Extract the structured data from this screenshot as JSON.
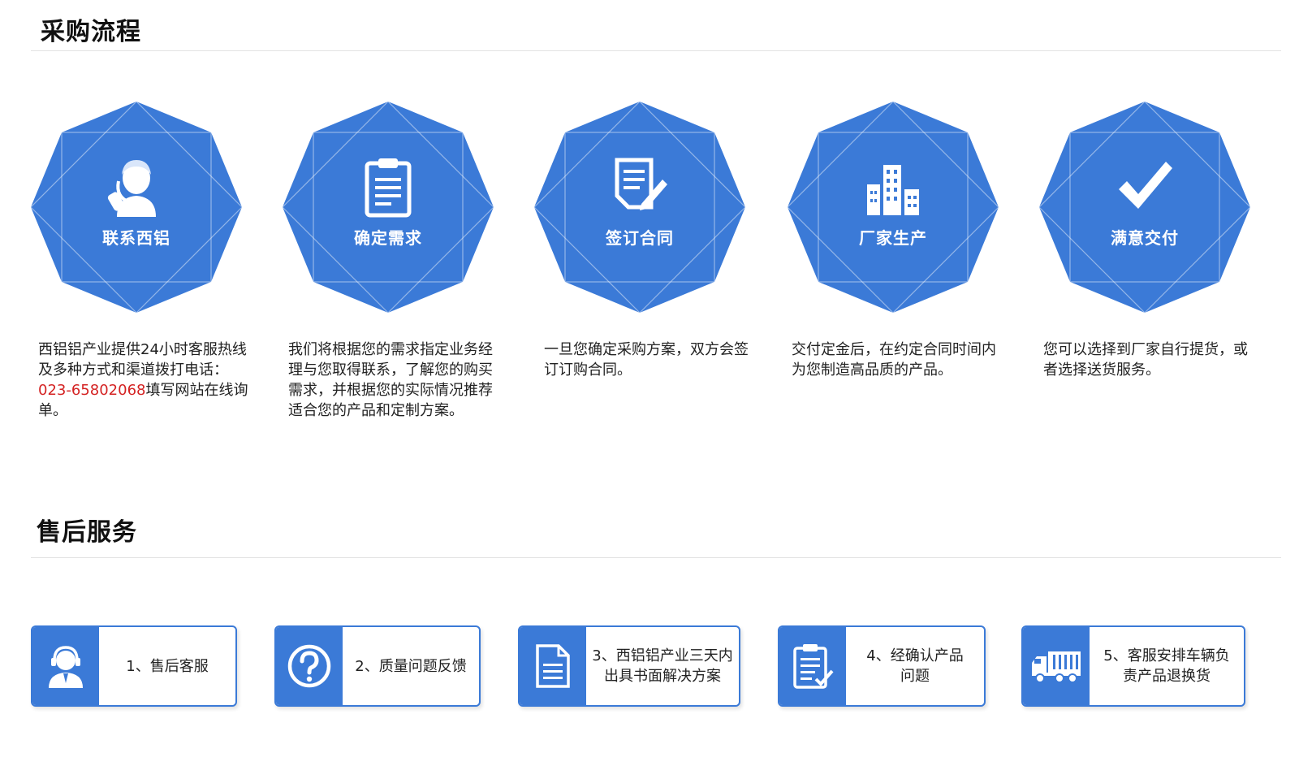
{
  "purchase": {
    "title": "采购流程",
    "steps": [
      {
        "label": "联系西铝",
        "icon": "customer-service-icon",
        "desc_before": "西铝铝产业提供24小时客服热线及多种方式和渠道拨打电话：",
        "phone": "023-65802068",
        "desc_after": "填写网站在线询单。"
      },
      {
        "label": "确定需求",
        "icon": "clipboard-icon",
        "desc": "我们将根据您的需求指定业务经理与您取得联系，了解您的购买需求，并根据您的实际情况推荐适合您的产品和定制方案。"
      },
      {
        "label": "签订合同",
        "icon": "contract-sign-icon",
        "desc": "一旦您确定采购方案，双方会签订订购合同。"
      },
      {
        "label": "厂家生产",
        "icon": "factory-building-icon",
        "desc": "交付定金后，在约定合同时间内为您制造高品质的产品。"
      },
      {
        "label": "满意交付",
        "icon": "checkmark-icon",
        "desc": "您可以选择到厂家自行提货，或者选择送货服务。"
      }
    ]
  },
  "after_sales": {
    "title": "售后服务",
    "items": [
      {
        "line1": "1、售后客服",
        "line2": "",
        "icon": "support-agent-icon"
      },
      {
        "line1": "2、质量问题反馈",
        "line2": "",
        "icon": "question-icon"
      },
      {
        "line1": "3、西铝铝产业三天内",
        "line2": "出具书面解决方案",
        "icon": "document-icon"
      },
      {
        "line1": "4、经确认产品",
        "line2": "问题",
        "icon": "checklist-icon"
      },
      {
        "line1": "5、客服安排车辆负",
        "line2": "责产品退换货",
        "icon": "truck-icon"
      }
    ]
  },
  "colors": {
    "brand_blue": "#3b7ad7",
    "phone_red": "#d42323"
  }
}
